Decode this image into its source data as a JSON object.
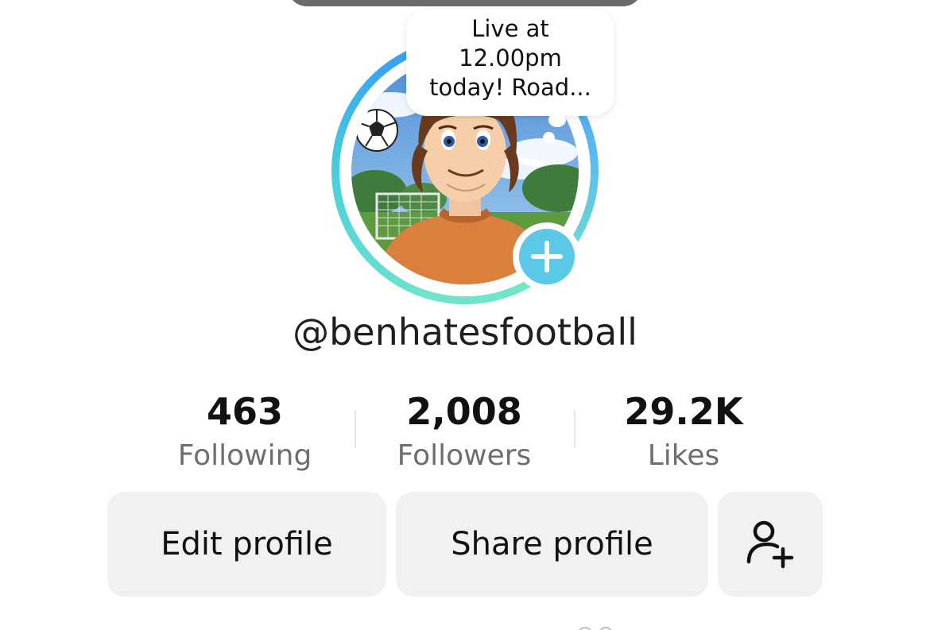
{
  "note": {
    "lines": [
      "Live at",
      "12.00pm",
      "today! Road..."
    ]
  },
  "profile": {
    "username": "@benhatesfootball"
  },
  "stats": {
    "following": {
      "value": "463",
      "label": "Following"
    },
    "followers": {
      "value": "2,008",
      "label": "Followers"
    },
    "likes": {
      "value": "29.2K",
      "label": "Likes"
    }
  },
  "actions": {
    "edit_profile": "Edit profile",
    "share_profile": "Share profile",
    "add_friend_icon": "person-add-icon"
  },
  "colors": {
    "story_ring_start": "#3b8ff2",
    "story_ring_end": "#6fe3cc",
    "add_story": "#5bc8e8",
    "button_bg": "#f1f1f1"
  }
}
